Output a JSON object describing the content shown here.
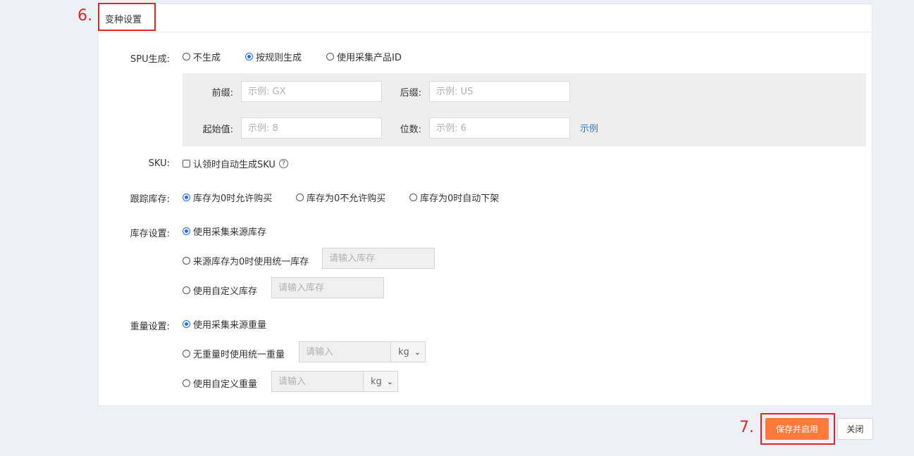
{
  "annotations": {
    "step6": "6.",
    "step7": "7."
  },
  "panel": {
    "title": "变种设置"
  },
  "spu": {
    "label": "SPU生成:",
    "options": [
      "不生成",
      "按规则生成",
      "使用采集产品ID"
    ],
    "selected": "按规则生成",
    "rule": {
      "prefix_label": "前缀:",
      "prefix_placeholder": "示例: GX",
      "suffix_label": "后缀:",
      "suffix_placeholder": "示例: US",
      "start_label": "起始值:",
      "start_placeholder": "示例: 8",
      "digits_label": "位数:",
      "digits_placeholder": "示例: 6",
      "example_link": "示例"
    }
  },
  "sku": {
    "label": "SKU:",
    "checkbox_label": "认领时自动生成SKU",
    "checked": false,
    "help_icon": "question-circle-icon"
  },
  "track_stock": {
    "label": "跟踪库存:",
    "options": [
      "库存为0时允许购买",
      "库存为0不允许购买",
      "库存为0时自动下架"
    ],
    "selected": "库存为0时允许购买"
  },
  "stock_settings": {
    "label": "库存设置:",
    "options": [
      "使用采集来源库存",
      "来源库存为0时使用统一库存",
      "使用自定义库存"
    ],
    "selected": "使用采集来源库存",
    "unified_placeholder": "请输入库存",
    "custom_placeholder": "请输入库存"
  },
  "weight_settings": {
    "label": "重量设置:",
    "options": [
      "使用采集来源重量",
      "无重量时使用统一重量",
      "使用自定义重量"
    ],
    "selected": "使用采集来源重量",
    "unified_placeholder": "请输入",
    "custom_placeholder": "请输入",
    "unit": "kg"
  },
  "footer": {
    "save_enable": "保存并启用",
    "close": "关闭"
  },
  "colors": {
    "accent": "#ff7a3d",
    "annotation": "#e0242a",
    "radio": "#1f6fe5",
    "link": "#2d78d0"
  }
}
